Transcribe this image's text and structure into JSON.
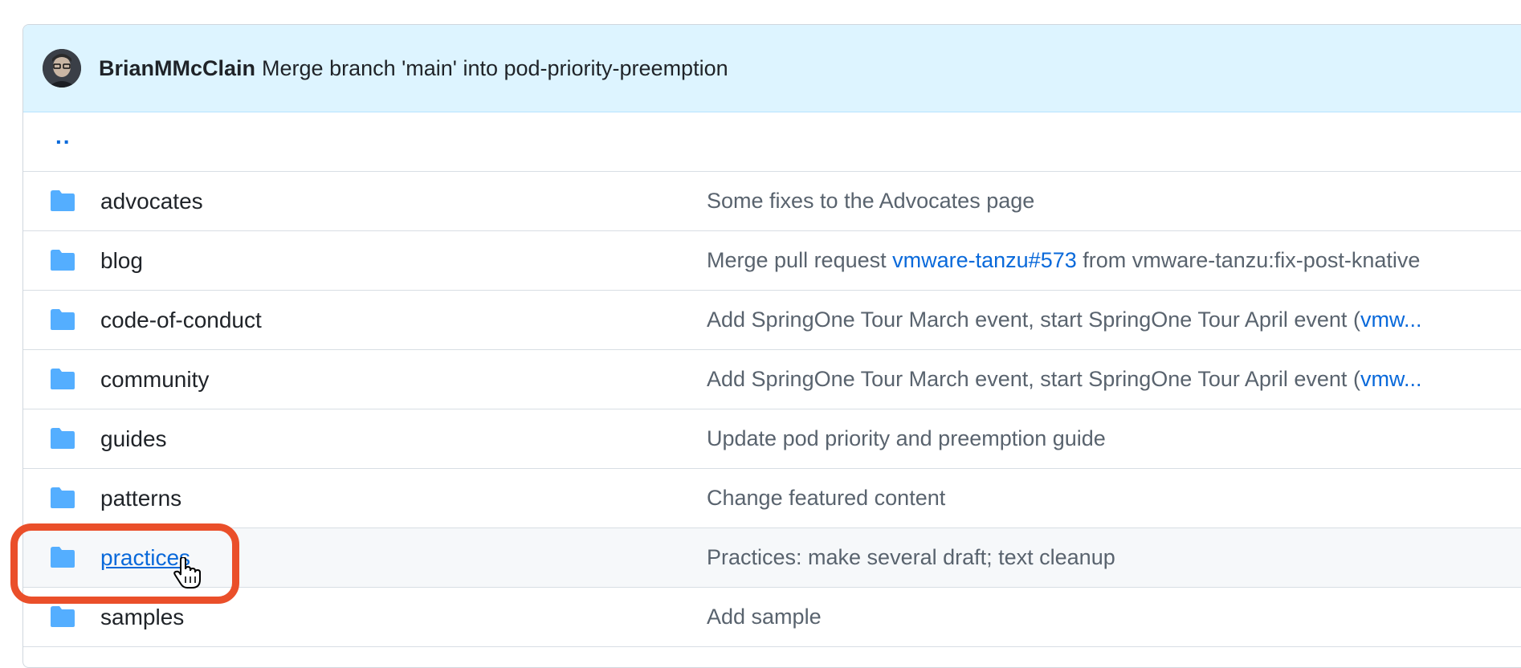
{
  "header": {
    "author": "BrianMMcClain",
    "message": "Merge branch 'main' into pod-priority-preemption"
  },
  "parent_link": "..",
  "rows": [
    {
      "name": "advocates",
      "commit": "Some fixes to the Advocates page"
    },
    {
      "name": "blog",
      "commit_pre": "Merge pull request ",
      "commit_link": "vmware-tanzu#573",
      "commit_post": " from vmware-tanzu:fix-post-knative"
    },
    {
      "name": "code-of-conduct",
      "commit_pre": "Add SpringOne Tour March event, start SpringOne Tour April event (",
      "commit_link": "vmw..."
    },
    {
      "name": "community",
      "commit_pre": "Add SpringOne Tour March event, start SpringOne Tour April event (",
      "commit_link": "vmw..."
    },
    {
      "name": "guides",
      "commit": "Update pod priority and preemption guide"
    },
    {
      "name": "patterns",
      "commit": "Change featured content"
    },
    {
      "name": "practices",
      "commit": "Practices: make several draft; text cleanup"
    },
    {
      "name": "samples",
      "commit": "Add sample"
    }
  ],
  "colors": {
    "folder": "#54aeff",
    "link": "#0969da",
    "highlight": "#ea4f2a"
  }
}
